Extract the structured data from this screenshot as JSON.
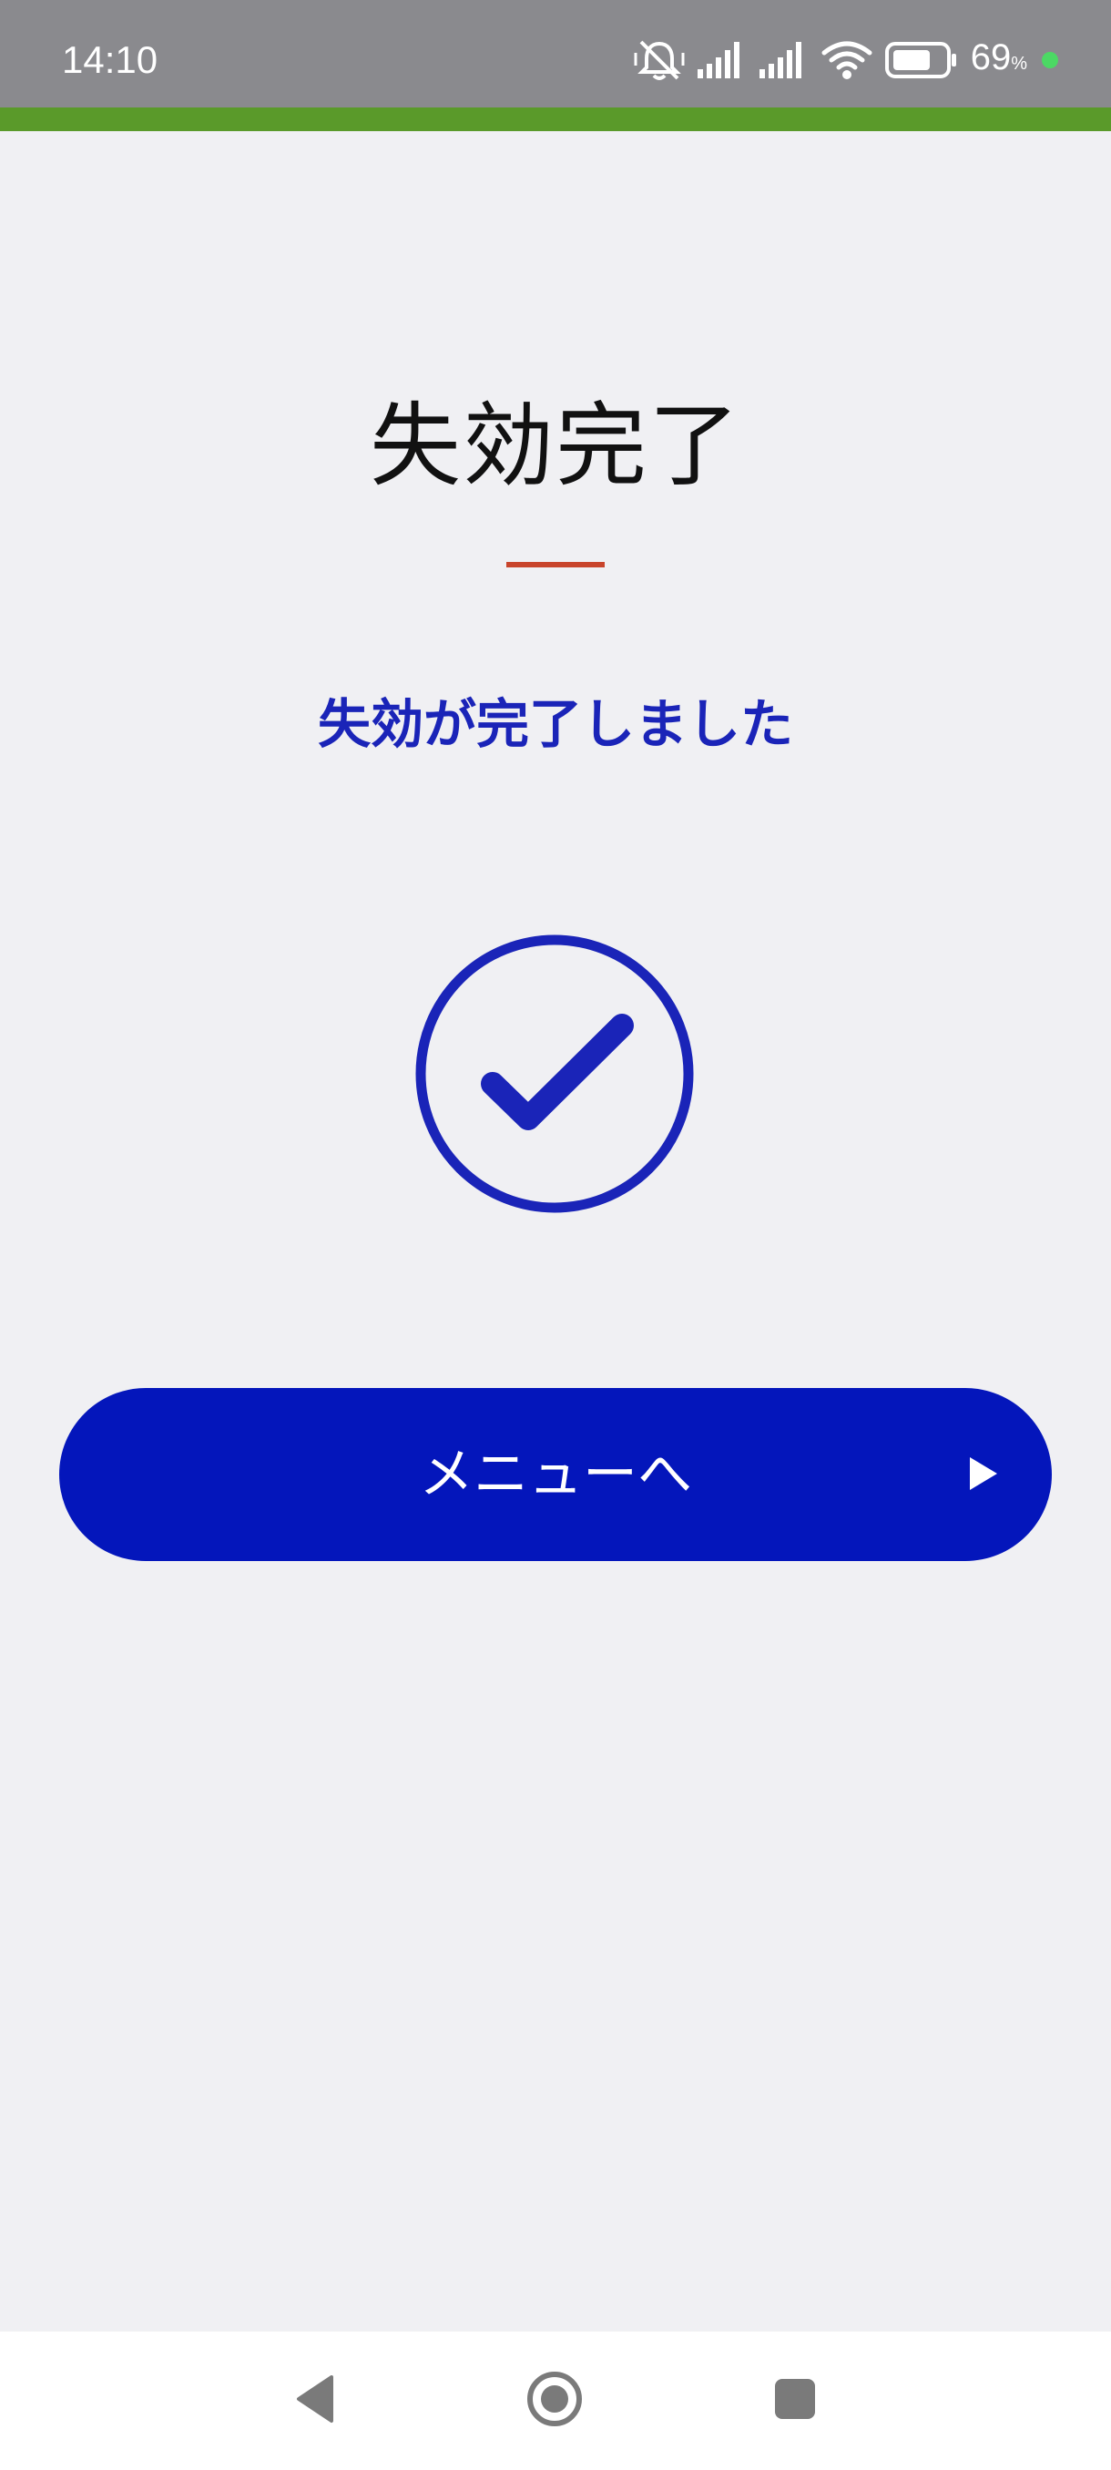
{
  "status_bar": {
    "time": "14:10",
    "battery_percent": "69",
    "battery_unit": "%",
    "icons": [
      "mute-icon",
      "signal-icon",
      "signal-icon",
      "wifi-icon",
      "battery-icon",
      "charging-dot"
    ]
  },
  "main": {
    "title": "失効完了",
    "message": "失効が完了しました",
    "status_icon": "check-circle-icon"
  },
  "actions": {
    "menu_button_label": "メニューへ",
    "menu_button_icon": "play-icon"
  },
  "nav_bar": {
    "items": [
      "back-icon",
      "home-icon",
      "recents-icon"
    ]
  },
  "colors": {
    "status_bar": "#8a8a8e",
    "accent_bar": "#5a9a2a",
    "background": "#f0f0f3",
    "primary": "#0416bb",
    "message_text": "#1a24b8",
    "divider": "#c8442b"
  }
}
